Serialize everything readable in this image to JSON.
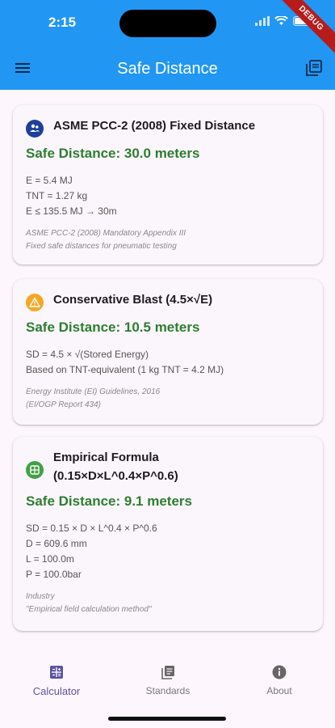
{
  "status": {
    "time": "2:15",
    "debug_label": "DEBUG"
  },
  "app_bar": {
    "title": "Safe Distance"
  },
  "cards": [
    {
      "title": "ASME PCC-2 (2008) Fixed Distance",
      "result": "Safe Distance: 30.0 meters",
      "icon": "people-icon",
      "icon_color": "#1e3f9a",
      "details": [
        "E = 5.4 MJ",
        "TNT = 1.27 kg",
        "E ≤ 135.5 MJ → 30m"
      ],
      "refs": [
        "ASME PCC-2 (2008) Mandatory Appendix III",
        "Fixed safe distances for pneumatic testing"
      ]
    },
    {
      "title": "Conservative Blast (4.5×√E)",
      "result": "Safe Distance: 10.5 meters",
      "icon": "warning-icon",
      "icon_color": "#f5a623",
      "details": [
        "SD = 4.5 × √(Stored Energy)",
        "Based on TNT-equivalent (1 kg TNT = 4.2 MJ)"
      ],
      "refs": [
        "Energy Institute (EI) Guidelines, 2016",
        "(EI/OGP Report 434)"
      ]
    },
    {
      "title_line1": "Empirical Formula",
      "title_line2": "(0.15×D×L^0.4×P^0.6)",
      "result": "Safe Distance: 9.1 meters",
      "icon": "calculator-icon",
      "icon_color": "#43a047",
      "details": [
        "SD = 0.15 × D × L^0.4 × P^0.6",
        "D = 609.6 mm",
        "L = 100.0m",
        "P = 100.0bar"
      ],
      "refs": [
        "Industry",
        "\"Empirical field calculation method\""
      ]
    }
  ],
  "nav": [
    {
      "label": "Calculator",
      "icon": "calculator-icon",
      "active": true
    },
    {
      "label": "Standards",
      "icon": "library-icon",
      "active": false
    },
    {
      "label": "About",
      "icon": "info-icon",
      "active": false
    }
  ],
  "colors": {
    "app_bar": "#2196f3",
    "result_green": "#2e7d32",
    "nav_active": "#5e52a3"
  }
}
